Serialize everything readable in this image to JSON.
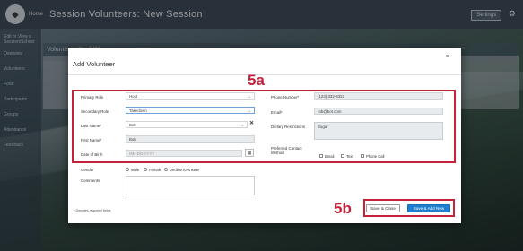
{
  "app": {
    "logo_text": "◆",
    "home_label": "Home",
    "page_title": "Session Volunteers: New Session",
    "settings_label": "Settings",
    "gear_glyph": "⚙"
  },
  "sidenav": {
    "items": [
      "Edit or View a Session/School",
      "Overview",
      "Volunteers",
      "Food",
      "Participants",
      "Groups",
      "Attendance",
      "Feedback"
    ]
  },
  "background": {
    "panel_title": "Volunteers Pool (2)"
  },
  "modal": {
    "title": "Add Volunteer",
    "close_glyph": "×",
    "fields": {
      "primary_role": {
        "label": "Primary Role",
        "value": "Host"
      },
      "secondary_role": {
        "label": "Secondary Role",
        "value": "Takedown"
      },
      "last_name": {
        "label": "Last Name*",
        "value": "Bolt"
      },
      "first_name": {
        "label": "First Name*",
        "value": "Bob"
      },
      "dob": {
        "label": "Date of Birth",
        "placeholder": "MM-DD-YYYY"
      },
      "phone": {
        "label": "Phone Number*",
        "value": "(123) 332-3322"
      },
      "email": {
        "label": "Email*",
        "value": "rob@bot.com"
      },
      "dietary": {
        "label": "Dietary Restrictions",
        "value": "Sugar"
      },
      "contact": {
        "label": "Preferred Contact Method",
        "options": [
          "Email",
          "Text",
          "Phone Call"
        ]
      },
      "gender": {
        "label": "Gender",
        "options": [
          "Male",
          "Female",
          "Decline to Answer"
        ]
      },
      "comments": {
        "label": "Comments",
        "value": ""
      }
    },
    "footnote": "* Denotes required fields",
    "buttons": {
      "save_close": "Save & Close",
      "save_add_new": "Save & Add New"
    }
  },
  "annotations": {
    "label_5a": "5a",
    "label_5b": "5b",
    "color": "#c4213a"
  },
  "colors": {
    "primary_button": "#1e7fd0",
    "topbar": "#3a4650"
  }
}
